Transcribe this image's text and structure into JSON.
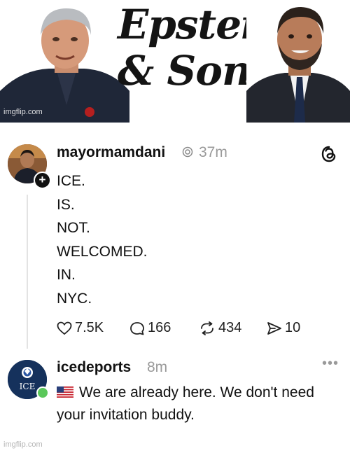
{
  "banner": {
    "title_line1": "Epstein",
    "title_line2": "& Son",
    "watermark": "imgflip.com"
  },
  "post1": {
    "username": "mayormamdani",
    "time": "37m",
    "lines": [
      "ICE.",
      "IS.",
      "NOT.",
      "WELCOMED.",
      "IN.",
      "NYC."
    ],
    "likes": "7.5K",
    "replies": "166",
    "reposts": "434",
    "shares": "10"
  },
  "post2": {
    "username": "icedeports",
    "time": "8m",
    "avatar_text": "ICE",
    "text": "We are already here. We don't need your invitation buddy."
  },
  "footer": {
    "watermark": "imgflip.com"
  },
  "icons": {
    "verified": "verified-icon",
    "threads": "threads-logo-icon",
    "more": "more-options-icon",
    "flag": "us-flag-icon"
  },
  "colors": {
    "accent_text": "#111111",
    "muted_text": "#9a9a9a",
    "online_dot": "#5ac75a"
  }
}
